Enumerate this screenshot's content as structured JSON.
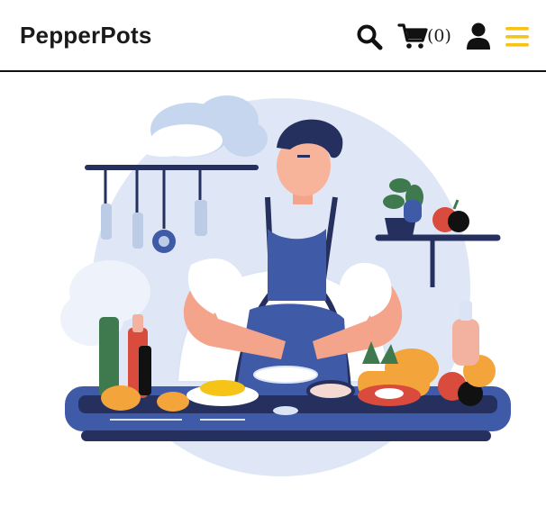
{
  "header": {
    "brand": "PepperPots",
    "cart_count": "(0)"
  },
  "icons": {
    "search": "search-icon",
    "cart": "cart-icon",
    "user": "user-icon",
    "menu": "hamburger-menu-icon"
  },
  "colors": {
    "accent": "#f6c419",
    "text": "#1a1a1a",
    "navy": "#26305f",
    "blue": "#3f5aa6",
    "light_blue": "#dbe4f5"
  },
  "hero": {
    "image": "chef-cooking-illustration"
  }
}
